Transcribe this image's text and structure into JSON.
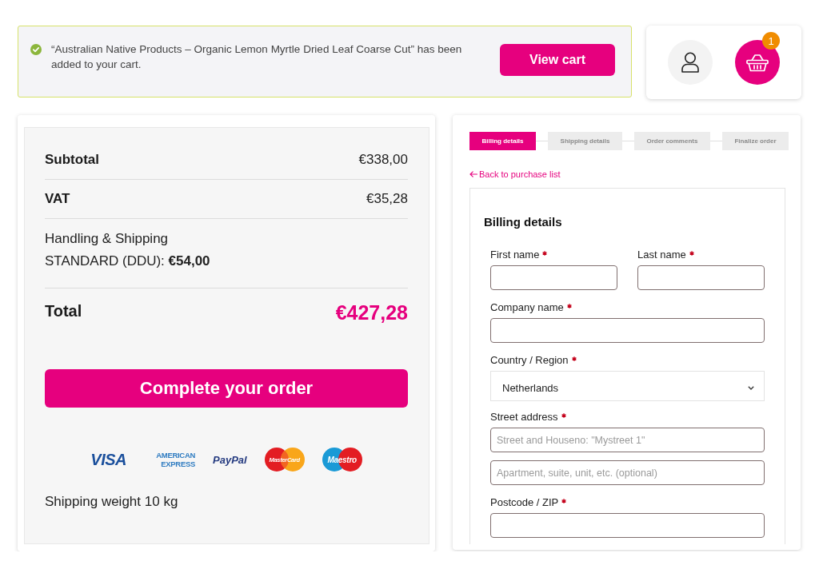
{
  "notice": {
    "message": "“Australian Native Products – Organic Lemon Myrtle Dried Leaf Coarse Cut” has been added to your cart.",
    "button": "View cart"
  },
  "header": {
    "cart_count": "1"
  },
  "order_summary": {
    "rows": [
      {
        "kind": "line",
        "label": "Subtotal",
        "value": "€338,00"
      },
      {
        "kind": "line",
        "label": "VAT",
        "value": "€35,28"
      },
      {
        "kind": "shipping",
        "label": "Handling & Shipping",
        "value": "STANDARD (DDU): **€54,00**"
      },
      {
        "kind": "total",
        "label": "Total",
        "value": "€427,28"
      }
    ],
    "button": "Complete your order",
    "payment_logos": [
      {
        "kind": "visa",
        "text": "VISA"
      },
      {
        "kind": "amex",
        "text": "AMERICAN EXPRESS"
      },
      {
        "kind": "paypal",
        "text": "PayPal"
      },
      {
        "kind": "mastercard",
        "text": "MasterCard"
      },
      {
        "kind": "maestro",
        "text": "Maestro"
      }
    ],
    "shipping_weight": "Shipping weight 10 kg"
  },
  "checkout": {
    "steps": [
      {
        "label": "Billing details",
        "selected": true
      },
      {
        "label": "Shipping details",
        "selected": false
      },
      {
        "label": "Order comments",
        "selected": false
      },
      {
        "label": "Finalize order",
        "selected": false
      }
    ],
    "back_link": "Back to purchase list",
    "form": {
      "title": "Billing details",
      "rows": [
        {
          "fields": [
            {
              "kind": "text",
              "label": "First name",
              "required": true
            },
            {
              "kind": "text",
              "label": "Last name",
              "required": true
            }
          ]
        },
        {
          "fields": [
            {
              "kind": "text",
              "label": "Company name",
              "required": true
            }
          ]
        },
        {
          "fields": [
            {
              "kind": "select",
              "label": "Country / Region",
              "required": true,
              "value": "Netherlands"
            }
          ]
        },
        {
          "fields": [
            {
              "kind": "text",
              "label": "Street address",
              "required": true,
              "placeholders": [
                "Street and Houseno: \"Mystreet 1\"",
                "Apartment, suite, unit, etc. (optional)"
              ]
            }
          ]
        },
        {
          "fields": [
            {
              "kind": "text",
              "label": "Postcode / ZIP",
              "required": true
            }
          ]
        }
      ]
    }
  }
}
